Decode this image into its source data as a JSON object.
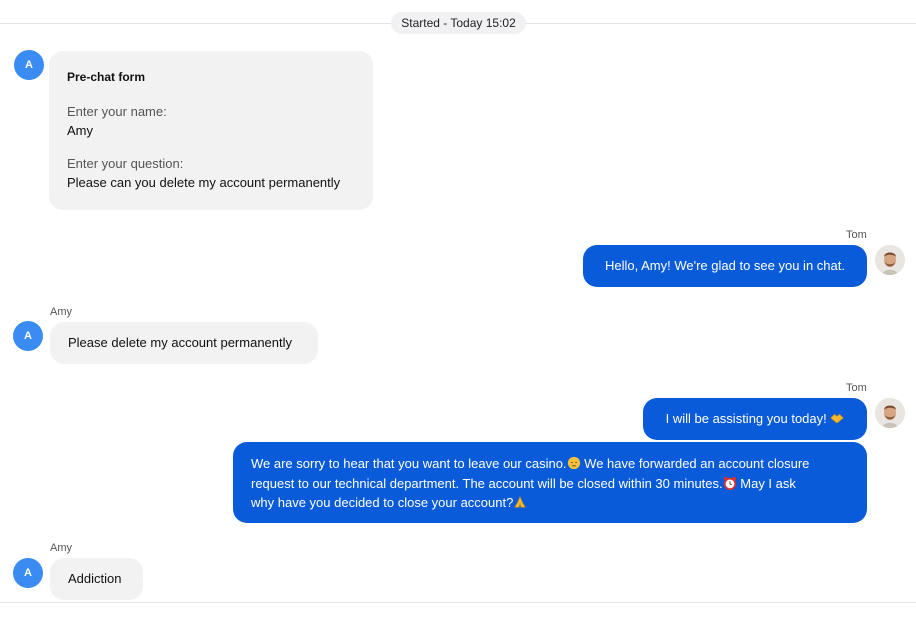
{
  "session": {
    "started_label": "Started - Today 15:02"
  },
  "prechat": {
    "title": "Pre-chat form",
    "name_label": "Enter your name:",
    "name_value": "Amy",
    "question_label": "Enter your question:",
    "question_value": "Please can you delete my account permanently"
  },
  "visitor": {
    "name": "Amy",
    "initial": "A"
  },
  "agent": {
    "name": "Tom"
  },
  "messages": [
    {
      "from": "agent",
      "text": "Hello, Amy! We're glad to see you in chat."
    },
    {
      "from": "visitor",
      "text": "Please delete my account permanently"
    },
    {
      "from": "agent",
      "text": "I will be assisting you today!"
    },
    {
      "from": "agent",
      "line1a": "We are sorry to hear that you want to leave our casino.",
      "line1b": "We have forwarded an account closure",
      "line2a": "request to our technical department. The account will be closed within 30 minutes.",
      "line2b": "May I ask",
      "line3": "why have you decided to close your account?"
    },
    {
      "from": "visitor",
      "text": "Addiction"
    }
  ],
  "colors": {
    "agent_bubble": "#0a5bd9",
    "visitor_bubble": "#f2f2f2",
    "visitor_avatar": "#3b8cf2"
  },
  "icons": [
    "handshake-emoji",
    "pensive-face-emoji",
    "alarm-clock-emoji",
    "folded-hands-emoji"
  ]
}
